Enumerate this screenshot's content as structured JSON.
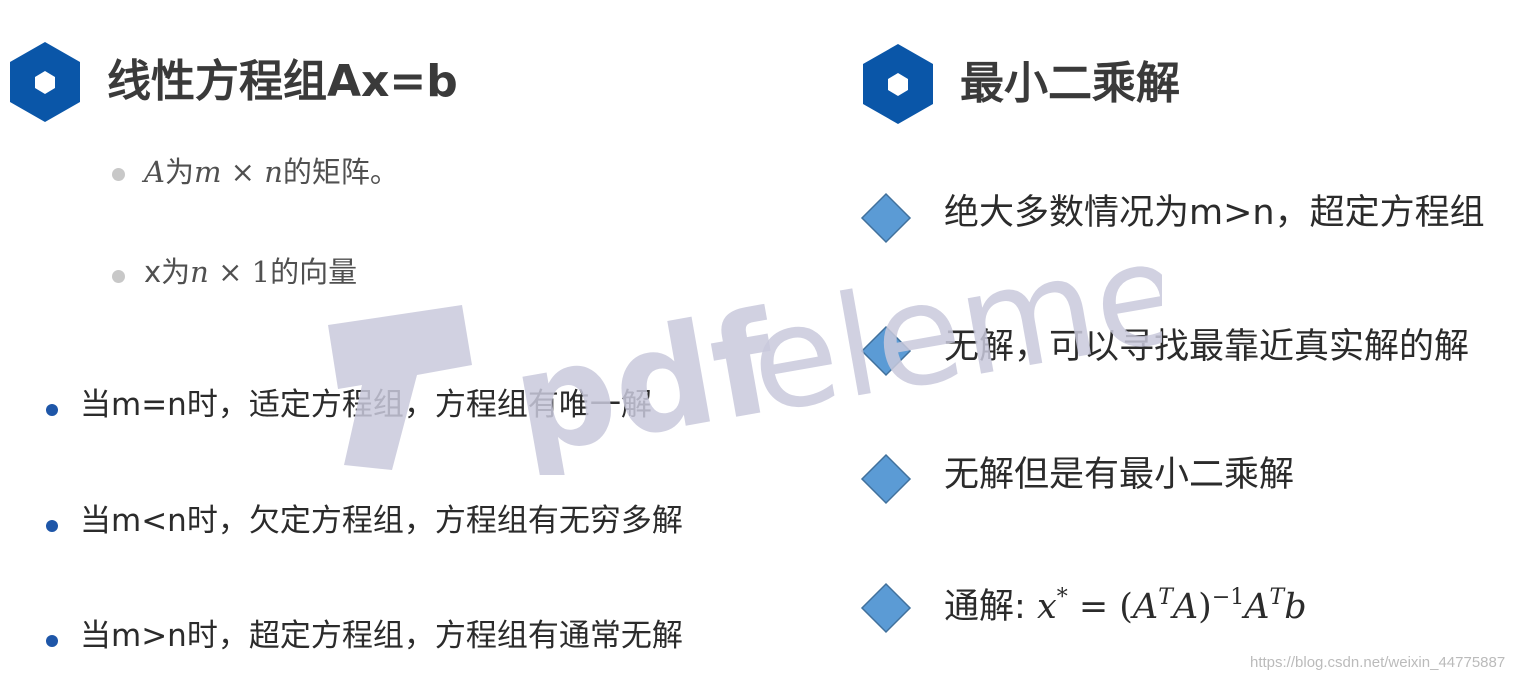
{
  "left": {
    "heading": "线性方程组Ax=b",
    "sub_items": [
      {
        "math": "A",
        "text1": "为",
        "math2": "m",
        "op": " × ",
        "math3": "n",
        "text2": "的矩阵。"
      },
      {
        "text0": "x为",
        "math": "n",
        "op": " × ",
        "num": "1",
        "text2": "的向量"
      }
    ],
    "items": [
      "当m=n时，适定方程组，方程组有唯一解",
      "当m<n时，欠定方程组，方程组有无穷多解",
      "当m>n时，超定方程组，方程组有通常无解"
    ]
  },
  "right": {
    "heading": "最小二乘解",
    "items": [
      "绝大多数情况为m>n，超定方程组",
      "无解，可以寻找最靠近真实解的解",
      "无解但是有最小二乘解"
    ],
    "formula_label": "通解:",
    "formula": {
      "x": "x",
      "star": "*",
      "eq": " = (",
      "A1": "A",
      "T1": "T",
      "A2": "A",
      "close": ")",
      "inv": "−1",
      "A3": "A",
      "T2": "T",
      "b": "b"
    }
  },
  "watermark": {
    "text": "pdfelement"
  },
  "footer": {
    "url": "https://blog.csdn.net/weixin_44775887"
  },
  "colors": {
    "hex_blue": "#0a56a8",
    "diamond_blue": "#5b9bd5",
    "bullet_blue": "#1e56a8",
    "watermark": "#cfcfe0"
  }
}
